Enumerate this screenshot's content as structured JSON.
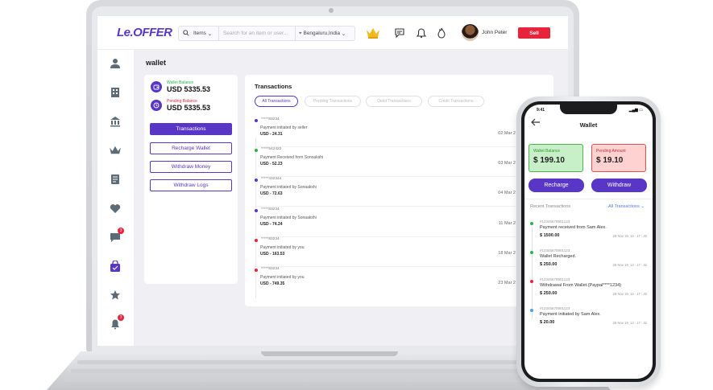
{
  "brand": {
    "logo": "Le.OFFER",
    "accent": "#5a36c6",
    "danger": "#e8243b"
  },
  "topnav": {
    "search_category": "Items",
    "search_placeholder": "Search for an item or user...",
    "location": "Bengaluru,India",
    "username": "John Peter",
    "sell_label": "Sell"
  },
  "sidebar": {
    "items": [
      "user-icon",
      "building-icon",
      "bank-icon",
      "crown-icon",
      "document-icon",
      "heart-icon",
      "chat-icon",
      "bag-icon",
      "star-icon",
      "bell-icon"
    ],
    "chat_badge": "3",
    "bell_badge": "3"
  },
  "wallet": {
    "title": "wallet",
    "wallet_balance_label": "Wallet Balance",
    "wallet_balance": "USD 5335.53",
    "pending_balance_label": "Pending Balance",
    "pending_balance": "USD 5335.53",
    "buttons": [
      "Transactions",
      "Recharge Wallet",
      "Withdraw Money",
      "Withdraw Logs"
    ]
  },
  "transactions": {
    "title": "Transactions",
    "tabs": [
      "All Transactions",
      "Pending Transactions",
      "Debit Transactions",
      "Credit Transactions"
    ],
    "rows": [
      {
        "id": "*****83234",
        "desc": "Payment initiated by seller",
        "amount": "USD - 24.31",
        "date": "02 Mar 2",
        "dot": "#5a36c6"
      },
      {
        "id": "*****542422",
        "desc": "Payment Received from Sonoakshi",
        "amount": "USD - 52.23",
        "date": "03 Mar 2",
        "dot": "#2bb24c"
      },
      {
        "id": "*****432344",
        "desc": "Payment initiated by Sonaakshi",
        "amount": "USD - 72.63",
        "date": "04 Mar 2",
        "dot": "#5a36c6"
      },
      {
        "id": "*****83234",
        "desc": "Payment initiated by Sonaakshi",
        "amount": "USD - 74.24",
        "date": "11 Mar 2",
        "dot": "#5a36c6"
      },
      {
        "id": "*****83234",
        "desc": "Payment initiated by you",
        "amount": "USD - 163.53",
        "date": "18 Mar 2",
        "dot": "#e8243b"
      },
      {
        "id": "*****83234",
        "desc": "Payment initiated by you",
        "amount": "USD - 749.35",
        "date": "23 Mar 2",
        "dot": "#e8243b"
      }
    ]
  },
  "phone": {
    "time": "9:41",
    "title": "Wallet",
    "wallet_balance_label": "Wallet Balance",
    "wallet_balance": "$ 199.10",
    "pending_amount_label": "Pending Amount",
    "pending_amount": "$ 19.10",
    "recharge_label": "Recharge",
    "withdraw_label": "Withdraw",
    "recent_label": "Recent Transactions",
    "all_label": "All Transactions",
    "transactions": [
      {
        "id": "#12345678901123",
        "desc": "Payment received from Sam Alex.",
        "amount": "$ 1500.00",
        "date": "28 Nov 19, 13 : 17 : 32",
        "dot": "#2bb24c"
      },
      {
        "id": "#12345678901123",
        "desc": "Wallet Recharged.",
        "amount": "$ 250.00",
        "date": "28 Nov 19, 13 : 17 : 32",
        "dot": "#2bb24c"
      },
      {
        "id": "#12345678901123",
        "desc": "Withdrawal From Wallet.(Paypal****1234)",
        "amount": "$ 250.00",
        "date": "28 Nov 19, 13 : 17 : 32",
        "dot": "#e8243b"
      },
      {
        "id": "#12345678901123",
        "desc": "Payment initiated by Sam Alex.",
        "amount": "$ 20.00",
        "date": "28 Nov 19, 13 : 17 : 32",
        "dot": "#4aa3e8"
      }
    ]
  }
}
